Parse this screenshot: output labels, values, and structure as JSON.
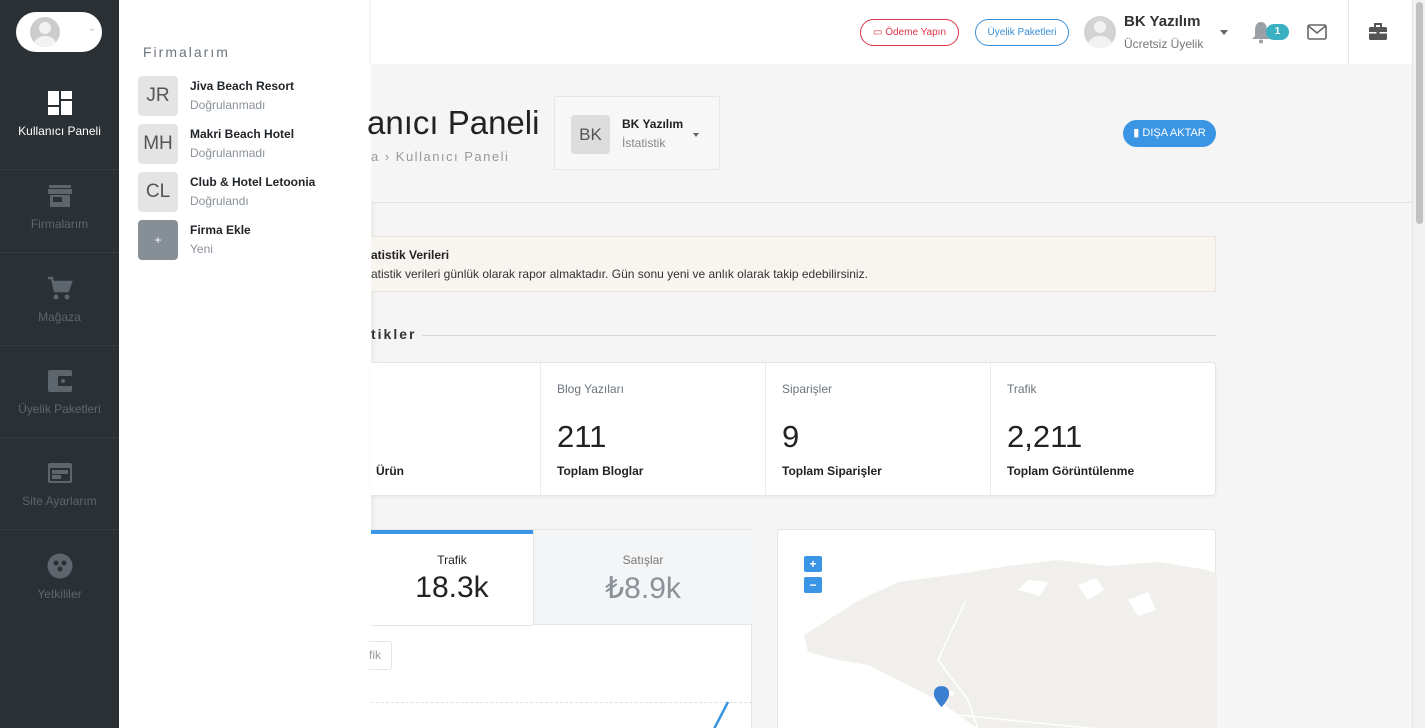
{
  "rail": {
    "items": [
      {
        "label": "Kullanıcı Paneli",
        "icon": "dashboard-icon"
      },
      {
        "label": "Firmalarım",
        "icon": "store-icon"
      },
      {
        "label": "Mağaza",
        "icon": "cart-icon"
      },
      {
        "label": "Üyelik Paketleri",
        "icon": "wallet-icon"
      },
      {
        "label": "Site Ayarlarım",
        "icon": "browser-icon"
      },
      {
        "label": "Yetkililer",
        "icon": "group-icon"
      }
    ]
  },
  "flyout": {
    "title": "Firmalarım",
    "firms": [
      {
        "abbr": "JR",
        "name": "Jiva Beach Resort",
        "status": "Doğrulanmadı"
      },
      {
        "abbr": "MH",
        "name": "Makri Beach Hotel",
        "status": "Doğrulanmadı"
      },
      {
        "abbr": "CL",
        "name": "Club & Hotel Letoonia",
        "status": "Doğrulandı"
      },
      {
        "abbr": "+",
        "name": "Firma Ekle",
        "status": "Yeni"
      }
    ]
  },
  "header": {
    "pay_label": "Ödeme Yapın",
    "packages_label": "Üyelik Paketleri",
    "user_name": "BK Yazılım",
    "user_plan": "Ücretsiz Üyelik",
    "notification_count": "1"
  },
  "page": {
    "title": "anıcı Paneli",
    "breadcrumb": "a › Kullanıcı Paneli",
    "firm_selector": {
      "abbr": "BK",
      "name": "BK Yazılım",
      "sub": "İstatistik"
    },
    "export_label": "DIŞA AKTAR"
  },
  "alert": {
    "title": "atistik Verileri",
    "text": "atistik verileri günlük olarak rapor almaktadır. Gün sonu yeni ve anlık olarak takip edebilirsiniz."
  },
  "section_title": "tikler",
  "stats": [
    {
      "label": "",
      "value": "",
      "sub": "Ürün"
    },
    {
      "label": "Blog Yazıları",
      "value": "211",
      "sub": "Toplam Bloglar"
    },
    {
      "label": "Siparişler",
      "value": "9",
      "sub": "Toplam Siparişler"
    },
    {
      "label": "Trafik",
      "value": "2,211",
      "sub": "Toplam Görüntülenme"
    }
  ],
  "traffic": {
    "tabs": [
      {
        "label": "Trafik",
        "value": "18.3k"
      },
      {
        "label": "Satışlar",
        "value": "₺8.9k"
      }
    ],
    "legend_label": "fik"
  },
  "map": {
    "zoom_in": "+",
    "zoom_out": "−"
  },
  "colors": {
    "accent": "#3a95e4",
    "rail": "#2b3035",
    "danger": "#dc3545"
  }
}
